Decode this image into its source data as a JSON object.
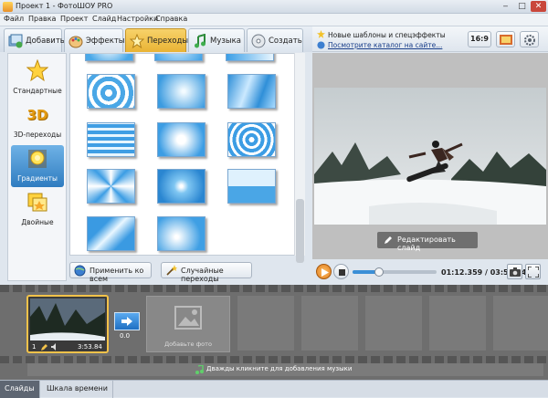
{
  "window": {
    "title": "Проект 1 - ФотоШОУ PRO"
  },
  "menu": [
    "Файл",
    "Правка",
    "Проект",
    "Слайд",
    "Настройки",
    "Справка"
  ],
  "tabs": [
    {
      "label": "Добавить",
      "icon": "add-photos-icon"
    },
    {
      "label": "Эффекты",
      "icon": "effects-palette-icon"
    },
    {
      "label": "Переходы",
      "icon": "star-icon",
      "active": true
    },
    {
      "label": "Музыка",
      "icon": "music-note-icon"
    },
    {
      "label": "Создать",
      "icon": "disc-icon"
    }
  ],
  "sidebar": {
    "items": [
      {
        "label": "Стандартные",
        "icon": "star-icon"
      },
      {
        "label": "3D-переходы",
        "icon": "3d-icon",
        "icon_text": "3D"
      },
      {
        "label": "Градиенты",
        "icon": "gradient-bulb-icon",
        "active": true
      },
      {
        "label": "Двойные",
        "icon": "double-icon"
      }
    ]
  },
  "transition_buttons": {
    "apply_all": "Применить ко всем",
    "random": "Случайные переходы"
  },
  "top_links": {
    "templates": "Новые шаблоны и спецэффекты",
    "catalog": "Посмотрите каталог на сайте..."
  },
  "aspect": "16:9",
  "preview": {
    "edit_slide": "Редактировать слайд"
  },
  "player": {
    "time": "01:12.359 / 03:53.840",
    "progress": 0.31
  },
  "timeline": {
    "slide": {
      "number": "1",
      "duration": "3:53.84"
    },
    "transition_duration": "0.0",
    "add_photo": "Добавьте фото",
    "music_hint": "Дважды кликните для добавления музыки"
  },
  "bottom_tabs": [
    "Слайды",
    "Шкала времени"
  ],
  "colors": {
    "accent": "#3b8fd6",
    "active_tab": "#f2c24a",
    "timeline_bg": "#6e6e6e"
  }
}
